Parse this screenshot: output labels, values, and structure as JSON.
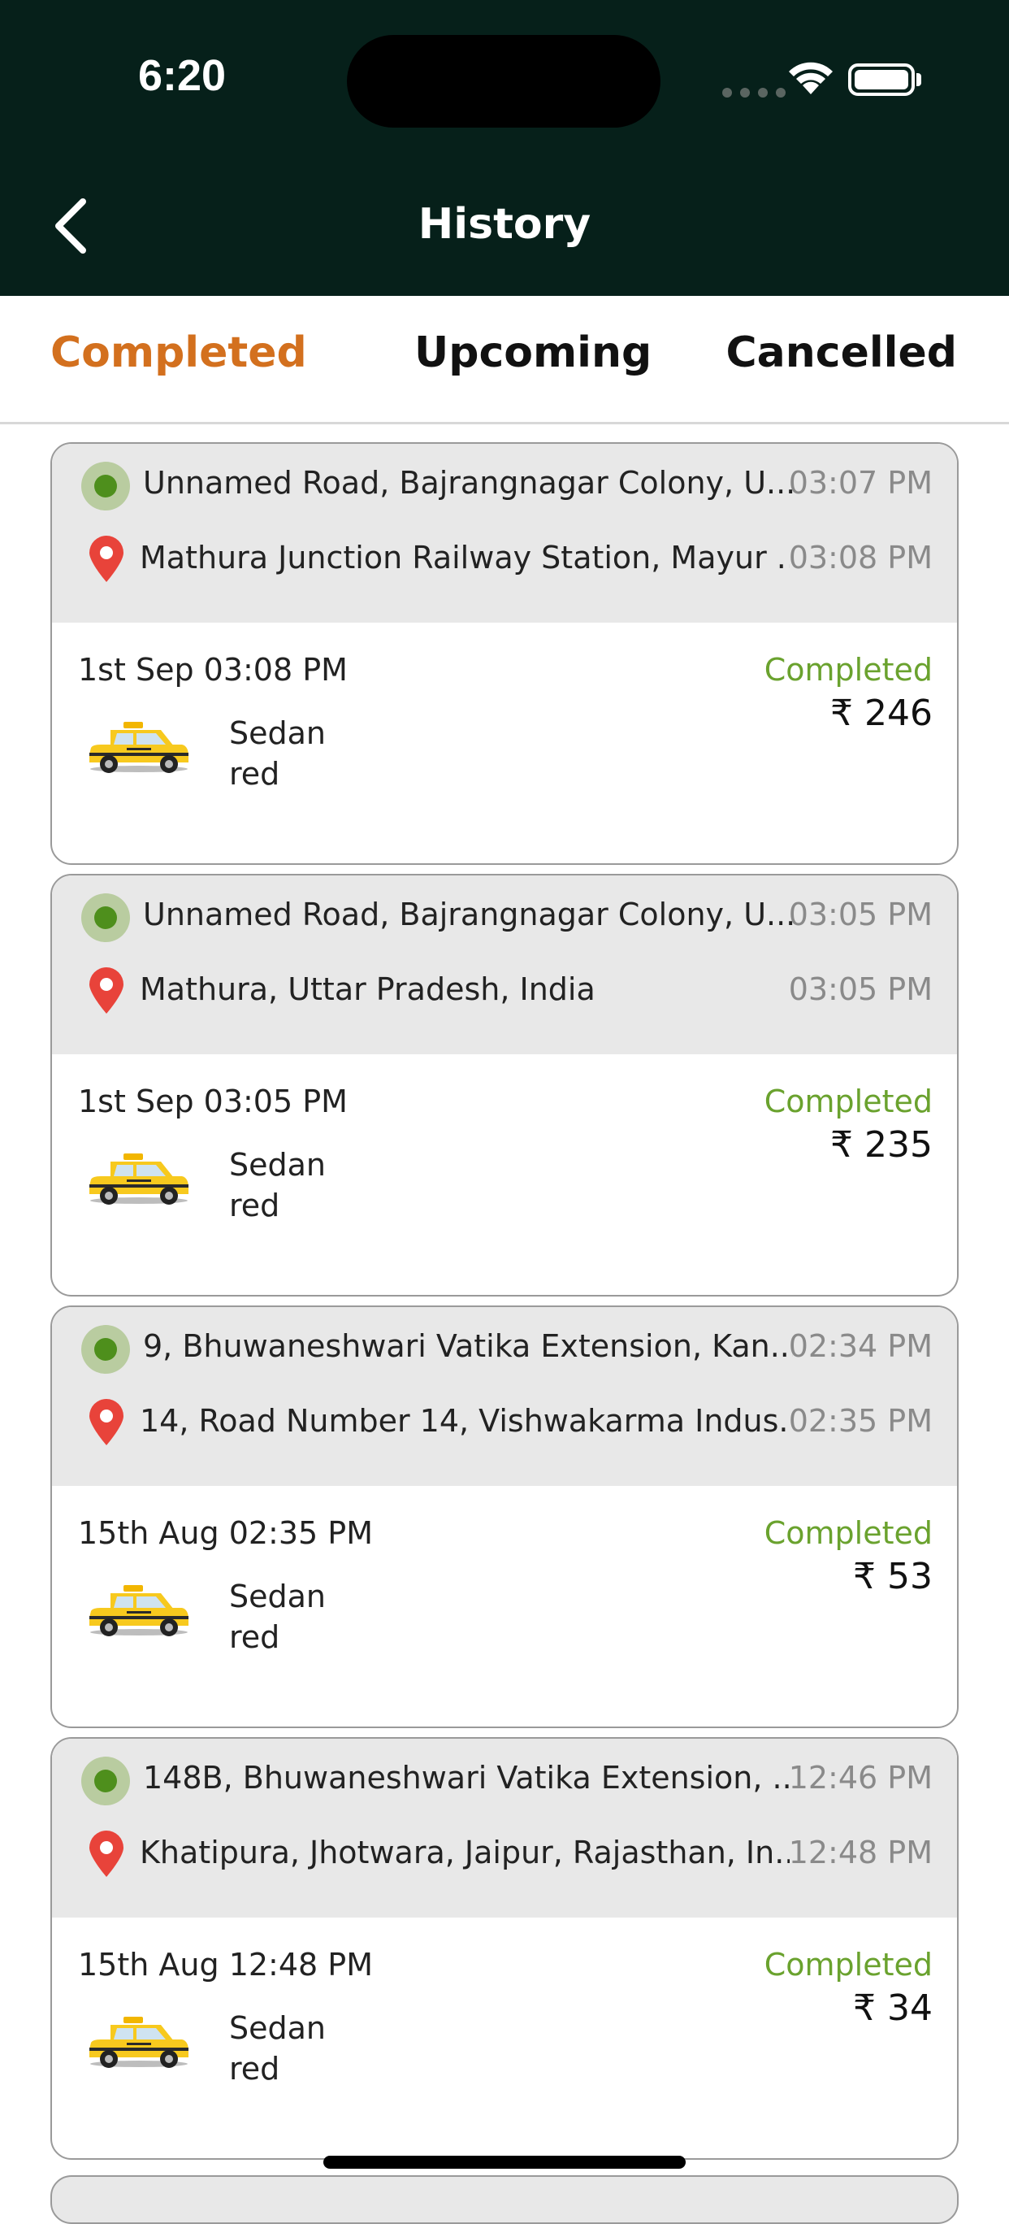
{
  "status_bar": {
    "time": "6:20"
  },
  "nav": {
    "title": "History"
  },
  "tabs": [
    {
      "label": "Completed",
      "active": true
    },
    {
      "label": "Upcoming",
      "active": false
    },
    {
      "label": "Cancelled",
      "active": false
    }
  ],
  "colors": {
    "header_bg": "#06201a",
    "active_tab": "#d3701e",
    "status_completed": "#6aa22e",
    "pickup_dot": "#4e8f1c",
    "drop_pin": "#e8433a"
  },
  "rides": [
    {
      "pickup": "Unnamed Road, Bajrangnagar Colony, U...",
      "pickup_time": "03:07 PM",
      "drop": "Mathura Junction Railway Station, Mayur ...",
      "drop_time": "03:08 PM",
      "date": "1st Sep 03:08 PM",
      "status": "Completed",
      "price": "₹ 246",
      "car_type": "Sedan",
      "car_color": "red"
    },
    {
      "pickup": "Unnamed Road, Bajrangnagar Colony, U...",
      "pickup_time": "03:05 PM",
      "drop": "Mathura, Uttar Pradesh, India",
      "drop_time": "03:05 PM",
      "date": "1st Sep 03:05 PM",
      "status": "Completed",
      "price": "₹ 235",
      "car_type": "Sedan",
      "car_color": "red"
    },
    {
      "pickup": "9, Bhuwaneshwari Vatika Extension, Kan...",
      "pickup_time": "02:34 PM",
      "drop": "14, Road Number 14, Vishwakarma Indus...",
      "drop_time": "02:35 PM",
      "date": "15th Aug 02:35 PM",
      "status": "Completed",
      "price": "₹ 53",
      "car_type": "Sedan",
      "car_color": "red"
    },
    {
      "pickup": "148B, Bhuwaneshwari Vatika Extension, ...",
      "pickup_time": "12:46 PM",
      "drop": "Khatipura, Jhotwara, Jaipur, Rajasthan, In...",
      "drop_time": "12:48 PM",
      "date": "15th Aug 12:48 PM",
      "status": "Completed",
      "price": "₹ 34",
      "car_type": "Sedan",
      "car_color": "red"
    }
  ]
}
